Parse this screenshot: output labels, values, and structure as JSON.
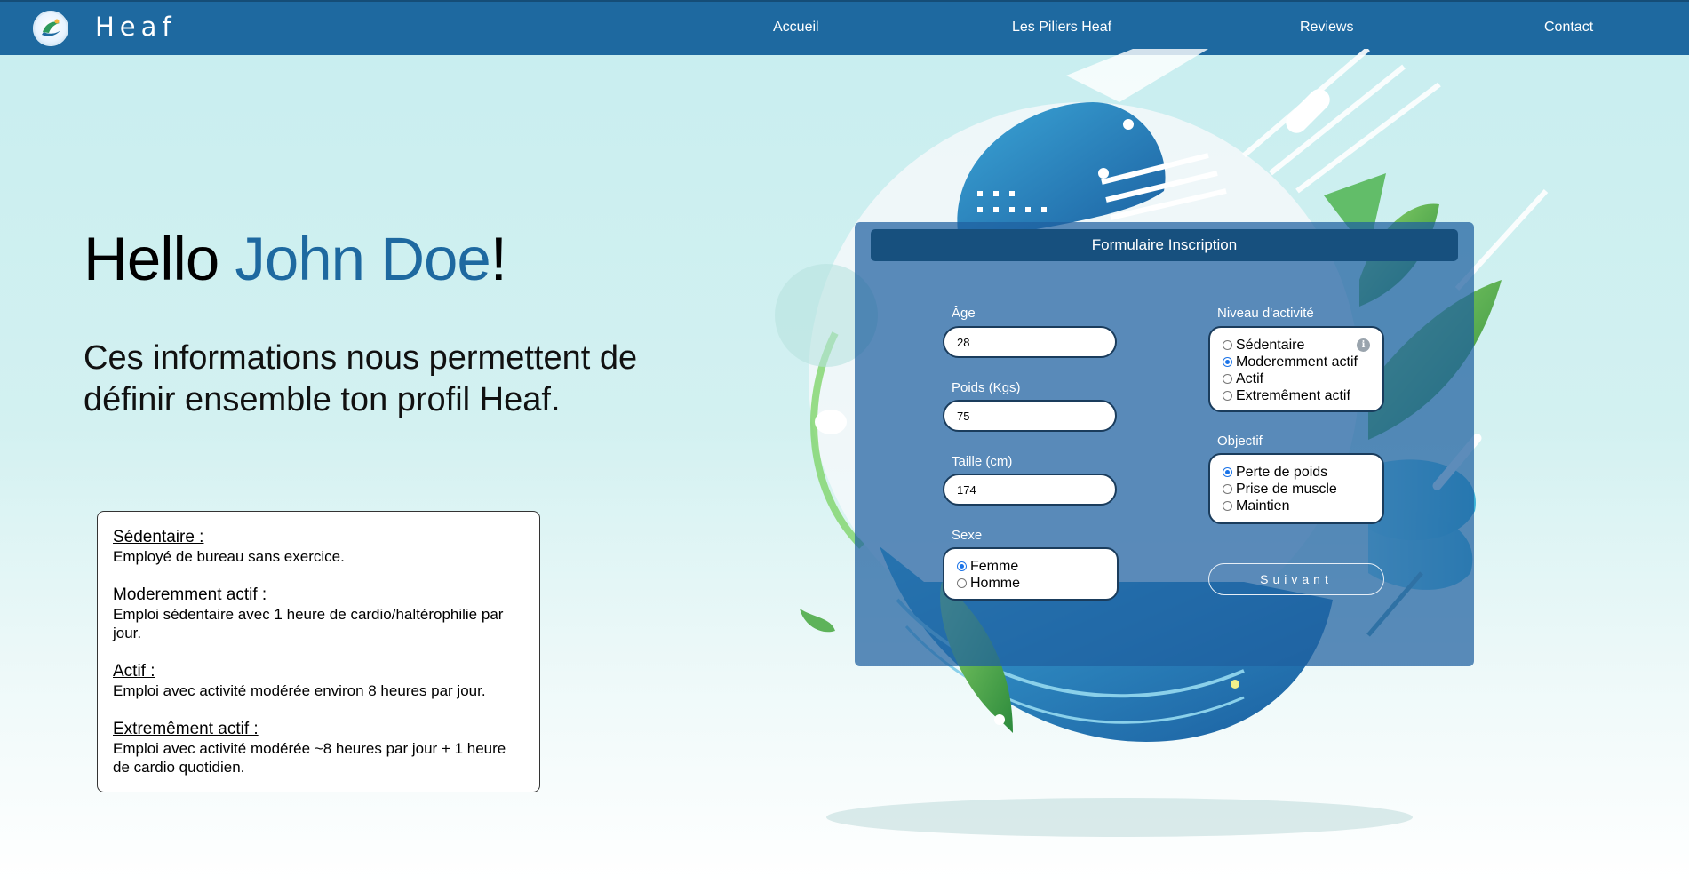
{
  "nav": {
    "brand": "Heaf",
    "links": [
      "Accueil",
      "Les Piliers Heaf",
      "Reviews",
      "Contact"
    ]
  },
  "hero": {
    "greeting": "Hello ",
    "name": "John Doe",
    "exclaim": "!",
    "subtitle": "Ces informations nous permettent de définir ensemble ton profil Heaf."
  },
  "info_box": {
    "items": [
      {
        "title": "Sédentaire :",
        "desc": "Employé de bureau sans exercice."
      },
      {
        "title": "Moderemment actif :",
        "desc": "Emploi sédentaire avec 1 heure de cardio/haltérophilie par jour."
      },
      {
        "title": "Actif :",
        "desc": "Emploi avec activité modérée environ 8 heures par jour."
      },
      {
        "title": "Extremêment actif :",
        "desc": "Emploi avec activité modérée ~8 heures par jour + 1 heure de cardio quotidien."
      }
    ]
  },
  "form": {
    "title": "Formulaire Inscription",
    "age": {
      "label": "Âge",
      "value": "28"
    },
    "weight": {
      "label": "Poids (Kgs)",
      "value": "75"
    },
    "height": {
      "label": "Taille (cm)",
      "value": "174"
    },
    "sex": {
      "label": "Sexe",
      "options": [
        "Femme",
        "Homme"
      ],
      "selected": "Femme"
    },
    "activity": {
      "label": "Niveau d'activité",
      "options": [
        "Sédentaire",
        "Moderemment actif",
        "Actif",
        "Extremêment actif"
      ],
      "selected": "Moderemment actif",
      "info_icon": "info-icon"
    },
    "objective": {
      "label": "Objectif",
      "options": [
        "Perte de poids",
        "Prise de muscle",
        "Maintien"
      ],
      "selected": "Perte de poids"
    },
    "next_label": "Suivant"
  },
  "colors": {
    "navbar": "#1e69a0",
    "accent": "#1e69a0",
    "form_panel": "#1e5fa0",
    "form_header": "#17507e"
  }
}
